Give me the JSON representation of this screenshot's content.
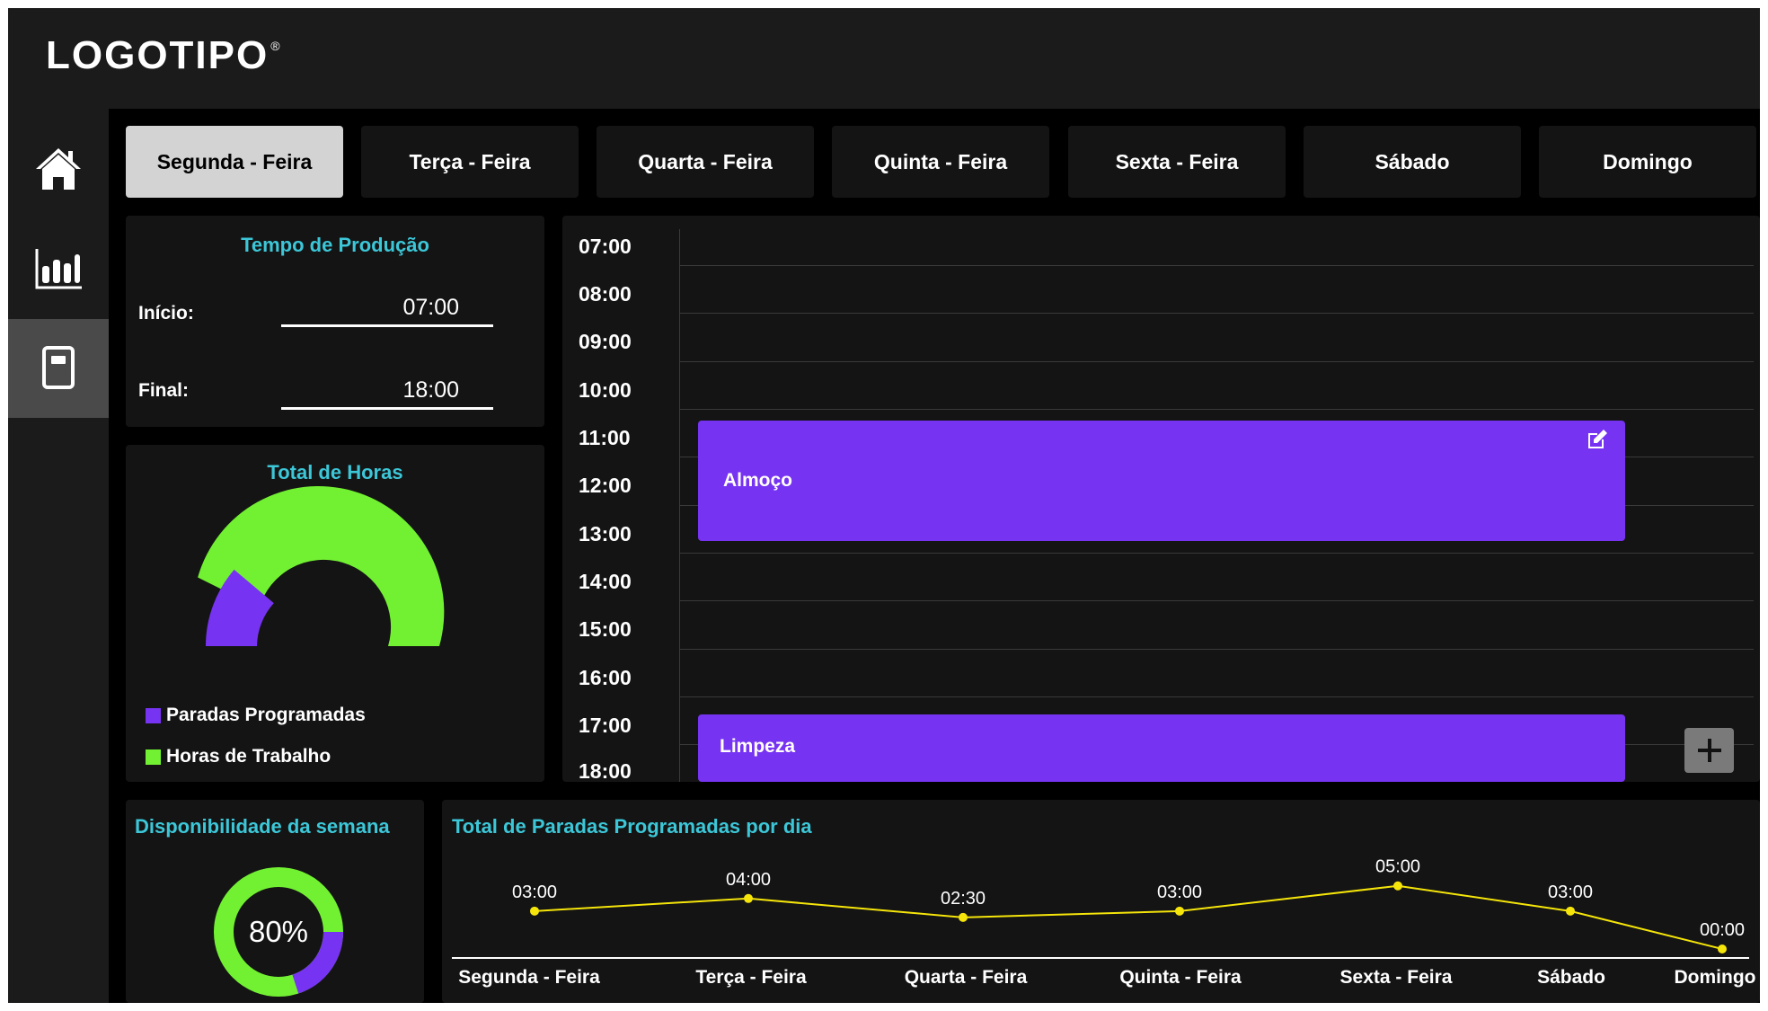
{
  "app": {
    "logo": "LOGOTIPO",
    "logo_mark": "®"
  },
  "sidebar": {
    "items": [
      {
        "icon": "home-icon",
        "active": false
      },
      {
        "icon": "bar-chart-icon",
        "active": false
      },
      {
        "icon": "document-icon",
        "active": true
      }
    ]
  },
  "tabs": [
    {
      "label": "Segunda - Feira",
      "active": true
    },
    {
      "label": "Terça - Feira",
      "active": false
    },
    {
      "label": "Quarta - Feira",
      "active": false
    },
    {
      "label": "Quinta - Feira",
      "active": false
    },
    {
      "label": "Sexta - Feira",
      "active": false
    },
    {
      "label": "Sábado",
      "active": false
    },
    {
      "label": "Domingo",
      "active": false
    }
  ],
  "production": {
    "title": "Tempo de Produção",
    "start_label": "Início:",
    "start_value": "07:00",
    "end_label": "Final:",
    "end_value": "18:00"
  },
  "total_hours": {
    "title": "Total de Horas",
    "legend": [
      {
        "label": "Paradas Programadas",
        "color": "#7733f2"
      },
      {
        "label": "Horas de Trabalho",
        "color": "#72f133"
      }
    ],
    "planned_stops_fraction": 0.22
  },
  "schedule": {
    "times": [
      "07:00",
      "08:00",
      "09:00",
      "10:00",
      "11:00",
      "12:00",
      "13:00",
      "14:00",
      "15:00",
      "16:00",
      "17:00",
      "18:00"
    ],
    "events": [
      {
        "label": "Almoço",
        "start": "11:00",
        "end": "13:00",
        "color": "#7733f2",
        "editable": true
      },
      {
        "label": "Limpeza",
        "start": "17:00",
        "end": "18:00",
        "color": "#7733f2",
        "editable": false
      }
    ],
    "add_icon": "plus-icon",
    "edit_icon": "edit-icon"
  },
  "availability": {
    "title": "Disponibilidade da semana",
    "value_label": "80%",
    "value": 0.8,
    "colors": {
      "available": "#72f133",
      "unavailable": "#7733f2"
    }
  },
  "stops_chart": {
    "title": "Total de Paradas Programadas por dia"
  },
  "chart_data": {
    "type": "line",
    "title": "Total de Paradas Programadas por dia",
    "categories": [
      "Segunda - Feira",
      "Terça - Feira",
      "Quarta - Feira",
      "Quinta - Feira",
      "Sexta - Feira",
      "Sábado",
      "Domingo"
    ],
    "values": [
      3.0,
      4.0,
      2.5,
      3.0,
      5.0,
      3.0,
      0.0
    ],
    "data_labels": [
      "03:00",
      "04:00",
      "02:30",
      "03:00",
      "05:00",
      "03:00",
      "00:00"
    ],
    "ylim": [
      0,
      6
    ],
    "color": "#f5e50a"
  },
  "colors": {
    "accent_title": "#3cc7d8",
    "purple": "#7733f2",
    "green": "#72f133",
    "line_yellow": "#f5e50a"
  }
}
